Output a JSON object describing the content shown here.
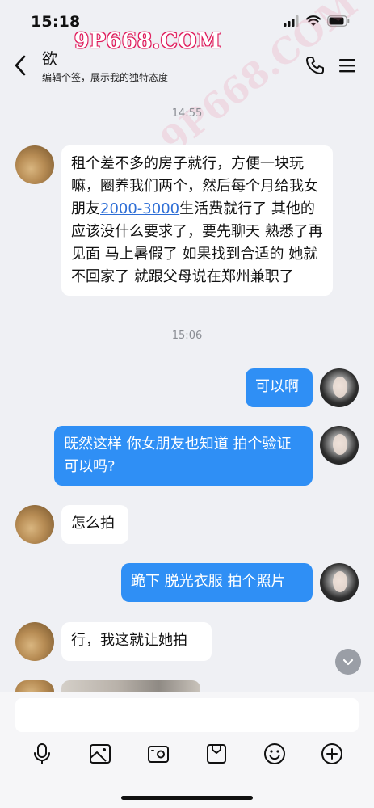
{
  "status_bar": {
    "time": "15:18"
  },
  "watermark": {
    "top": "9P668.COM",
    "diagonal": "9P668.COM"
  },
  "header": {
    "contact_name": "欲",
    "signature": "编辑个签，展示我的独特态度",
    "icons": [
      "back-arrow-icon",
      "phone-icon",
      "menu-icon"
    ]
  },
  "messages": {
    "ts1": "14:55",
    "m1_a": "租个差不多的房子就行，方便一块玩嘛，圈养我们两个，然后每个月给我女朋友",
    "m1_link": "2000-3000",
    "m1_b": "生活费就行了 其他的应该没什么要求了，要先聊天 熟悉了再见面 马上暑假了 如果找到合适的 她就不回家了 就跟父母说在郑州兼职了",
    "ts2": "15:06",
    "m2": "可以啊",
    "m3": "既然这样 你女朋友也知道 拍个验证可以吗?",
    "m4": "怎么拍",
    "m5": "跪下 脱光衣服 拍个照片",
    "m6": "行，我这就让她拍"
  },
  "input": {
    "placeholder": ""
  },
  "toolbar": {
    "icons": [
      "microphone-icon",
      "image-icon",
      "camera-icon",
      "file-icon",
      "emoji-icon",
      "plus-icon"
    ]
  },
  "colors": {
    "outgoing_bubble": "#2f8ff5",
    "incoming_bubble": "#ffffff",
    "background": "#eff0f4",
    "link": "#2f6fd6"
  }
}
